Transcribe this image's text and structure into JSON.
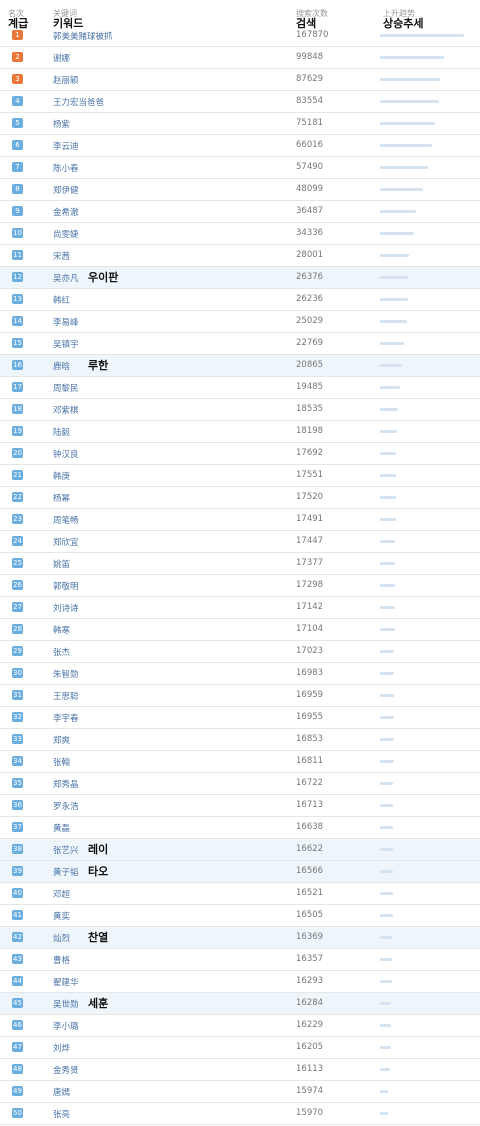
{
  "header": {
    "rank_zh": "名次",
    "rank_ko": "계급",
    "keyword_zh": "关键词",
    "keyword_ko": "키워드",
    "count_zh": "搜索次数",
    "count_ko": "검색",
    "trend_zh": "上升趋势",
    "trend_ko": "상승추세"
  },
  "colors": {
    "top3": "#e9773a",
    "others": "#6aaee0",
    "trend": "#d6e4f1",
    "highlight_row": "#eef6fb"
  },
  "rows": [
    {
      "rank": "1",
      "keyword": "郭美美赌球被抓",
      "count": "167870",
      "note": ""
    },
    {
      "rank": "2",
      "keyword": "谢娜",
      "count": "99848",
      "note": ""
    },
    {
      "rank": "3",
      "keyword": "赵丽颖",
      "count": "87629",
      "note": ""
    },
    {
      "rank": "4",
      "keyword": "王力宏当爸爸",
      "count": "83554",
      "note": ""
    },
    {
      "rank": "5",
      "keyword": "杨紫",
      "count": "75181",
      "note": ""
    },
    {
      "rank": "6",
      "keyword": "李云迪",
      "count": "66016",
      "note": ""
    },
    {
      "rank": "7",
      "keyword": "陈小春",
      "count": "57490",
      "note": ""
    },
    {
      "rank": "8",
      "keyword": "郑伊健",
      "count": "48099",
      "note": ""
    },
    {
      "rank": "9",
      "keyword": "金希澈",
      "count": "36487",
      "note": ""
    },
    {
      "rank": "10",
      "keyword": "尚雯婕",
      "count": "34336",
      "note": ""
    },
    {
      "rank": "11",
      "keyword": "宋茜",
      "count": "28001",
      "note": ""
    },
    {
      "rank": "12",
      "keyword": "吴亦凡",
      "count": "26376",
      "note": "우이판"
    },
    {
      "rank": "13",
      "keyword": "韩红",
      "count": "26236",
      "note": ""
    },
    {
      "rank": "14",
      "keyword": "李易峰",
      "count": "25029",
      "note": ""
    },
    {
      "rank": "15",
      "keyword": "吴镇宇",
      "count": "22769",
      "note": ""
    },
    {
      "rank": "16",
      "keyword": "鹿晗",
      "count": "20865",
      "note": "루한"
    },
    {
      "rank": "17",
      "keyword": "周黎民",
      "count": "19485",
      "note": ""
    },
    {
      "rank": "18",
      "keyword": "邓紫棋",
      "count": "18535",
      "note": ""
    },
    {
      "rank": "19",
      "keyword": "陆毅",
      "count": "18198",
      "note": ""
    },
    {
      "rank": "20",
      "keyword": "钟汉良",
      "count": "17692",
      "note": ""
    },
    {
      "rank": "21",
      "keyword": "韩庚",
      "count": "17551",
      "note": ""
    },
    {
      "rank": "22",
      "keyword": "杨幂",
      "count": "17520",
      "note": ""
    },
    {
      "rank": "23",
      "keyword": "周笔畅",
      "count": "17491",
      "note": ""
    },
    {
      "rank": "24",
      "keyword": "郑欣宜",
      "count": "17447",
      "note": ""
    },
    {
      "rank": "25",
      "keyword": "姚笛",
      "count": "17377",
      "note": ""
    },
    {
      "rank": "26",
      "keyword": "郭敬明",
      "count": "17298",
      "note": ""
    },
    {
      "rank": "27",
      "keyword": "刘诗诗",
      "count": "17142",
      "note": ""
    },
    {
      "rank": "28",
      "keyword": "韩寒",
      "count": "17104",
      "note": ""
    },
    {
      "rank": "29",
      "keyword": "张杰",
      "count": "17023",
      "note": ""
    },
    {
      "rank": "30",
      "keyword": "朱智勋",
      "count": "16983",
      "note": ""
    },
    {
      "rank": "31",
      "keyword": "王思聪",
      "count": "16959",
      "note": ""
    },
    {
      "rank": "32",
      "keyword": "李宇春",
      "count": "16955",
      "note": ""
    },
    {
      "rank": "33",
      "keyword": "郑爽",
      "count": "16853",
      "note": ""
    },
    {
      "rank": "34",
      "keyword": "张翰",
      "count": "16811",
      "note": ""
    },
    {
      "rank": "35",
      "keyword": "郑秀晶",
      "count": "16722",
      "note": ""
    },
    {
      "rank": "36",
      "keyword": "罗永浩",
      "count": "16713",
      "note": ""
    },
    {
      "rank": "37",
      "keyword": "黄磊",
      "count": "16638",
      "note": ""
    },
    {
      "rank": "38",
      "keyword": "张艺兴",
      "count": "16622",
      "note": "레이"
    },
    {
      "rank": "39",
      "keyword": "黄子韬",
      "count": "16566",
      "note": "타오"
    },
    {
      "rank": "40",
      "keyword": "邓超",
      "count": "16521",
      "note": ""
    },
    {
      "rank": "41",
      "keyword": "黄奕",
      "count": "16505",
      "note": ""
    },
    {
      "rank": "42",
      "keyword": "灿烈",
      "count": "16369",
      "note": "찬열"
    },
    {
      "rank": "43",
      "keyword": "曹格",
      "count": "16357",
      "note": ""
    },
    {
      "rank": "44",
      "keyword": "翟建华",
      "count": "16293",
      "note": ""
    },
    {
      "rank": "45",
      "keyword": "吴世勋",
      "count": "16284",
      "note": "세훈"
    },
    {
      "rank": "46",
      "keyword": "李小璐",
      "count": "16229",
      "note": ""
    },
    {
      "rank": "47",
      "keyword": "刘烨",
      "count": "16205",
      "note": ""
    },
    {
      "rank": "48",
      "keyword": "金秀贤",
      "count": "16113",
      "note": ""
    },
    {
      "rank": "49",
      "keyword": "唐嫣",
      "count": "15974",
      "note": ""
    },
    {
      "rank": "50",
      "keyword": "张亮",
      "count": "15970",
      "note": ""
    }
  ]
}
